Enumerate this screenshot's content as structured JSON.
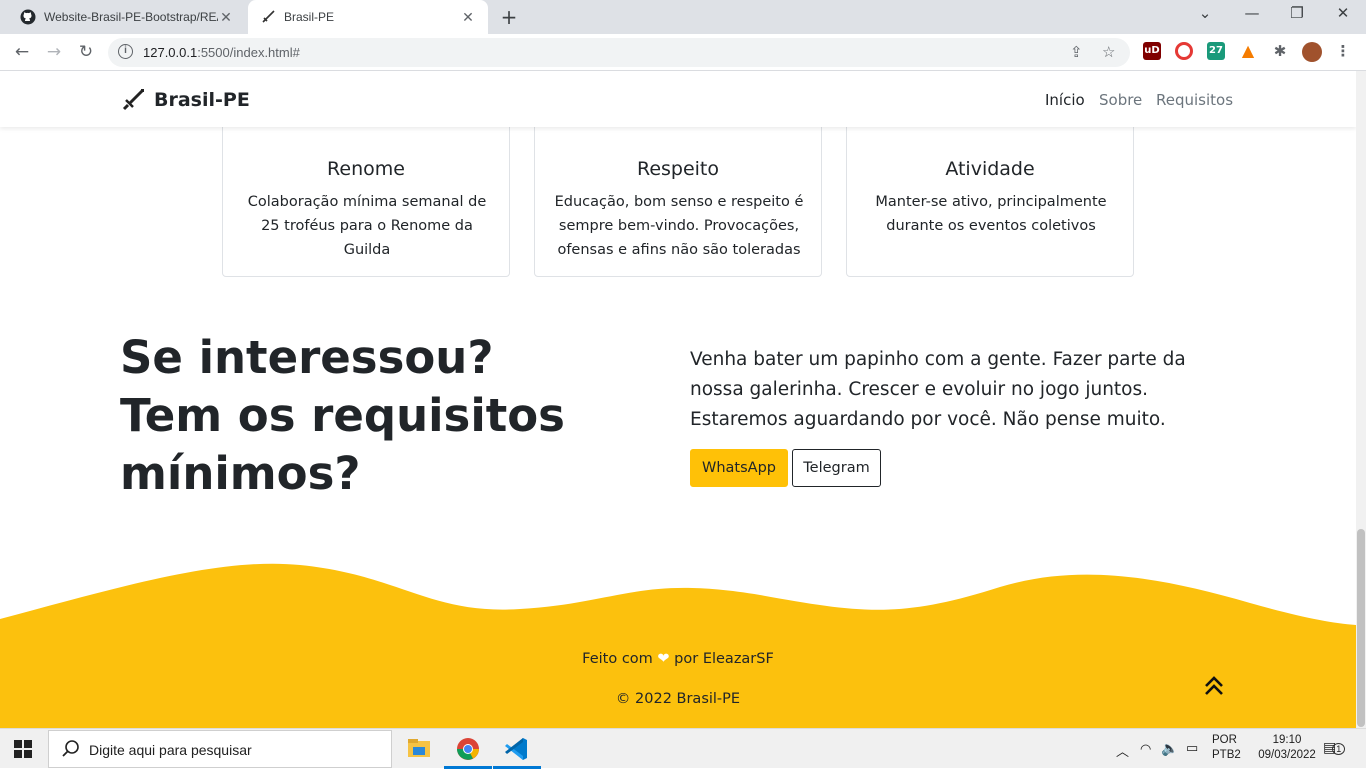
{
  "browser": {
    "tabs": [
      {
        "title": "Website-Brasil-PE-Bootstrap/README",
        "icon": "github-icon"
      },
      {
        "title": "Brasil-PE",
        "icon": "sword-icon"
      }
    ],
    "url_host": "127.0.0.1",
    "url_rest": ":5500/index.html#",
    "extensions": [
      {
        "name": "ublock-icon",
        "label": "uD",
        "color": "#800000"
      },
      {
        "name": "ext-red-icon",
        "label": "",
        "color": "#e53935"
      },
      {
        "name": "ext-27-icon",
        "label": "27",
        "color": "#1a9a7a"
      },
      {
        "name": "vlc-icon",
        "label": "",
        "color": "#f57c00"
      }
    ]
  },
  "navbar": {
    "brand": "Brasil-PE",
    "links": [
      {
        "label": "Início",
        "active": true
      },
      {
        "label": "Sobre",
        "active": false
      },
      {
        "label": "Requisitos",
        "active": false
      }
    ]
  },
  "cards": [
    {
      "title": "Renome",
      "text": "Colaboração mínima semanal de 25 troféus para o Renome da Guilda",
      "icon": "trophy-base-icon"
    },
    {
      "title": "Respeito",
      "text": "Educação, bom senso e respeito é sempre bem-vindo. Provocações, ofensas e afins não são toleradas",
      "icon": "shield-icon"
    },
    {
      "title": "Atividade",
      "text": "Manter-se ativo, principalmente durante os eventos coletivos",
      "icon": "smiley-icon"
    }
  ],
  "cta": {
    "title": "Se interessou? Tem os requisitos mínimos?",
    "text": "Venha bater um papinho com a gente. Fazer parte da nossa galerinha. Crescer e evoluir no jogo juntos. Estaremos aguardando por você. Não pense muito.",
    "whatsapp": "WhatsApp",
    "telegram": "Telegram"
  },
  "footer": {
    "made_prefix": "Feito com",
    "made_suffix": "por EleazarSF",
    "copyright": "© 2022 Brasil-PE",
    "color": "#fcc10d"
  },
  "taskbar": {
    "search_placeholder": "Digite aqui para pesquisar",
    "lang1": "POR",
    "lang2": "PTB2",
    "time": "19:10",
    "date": "09/03/2022",
    "notifications": "1"
  }
}
